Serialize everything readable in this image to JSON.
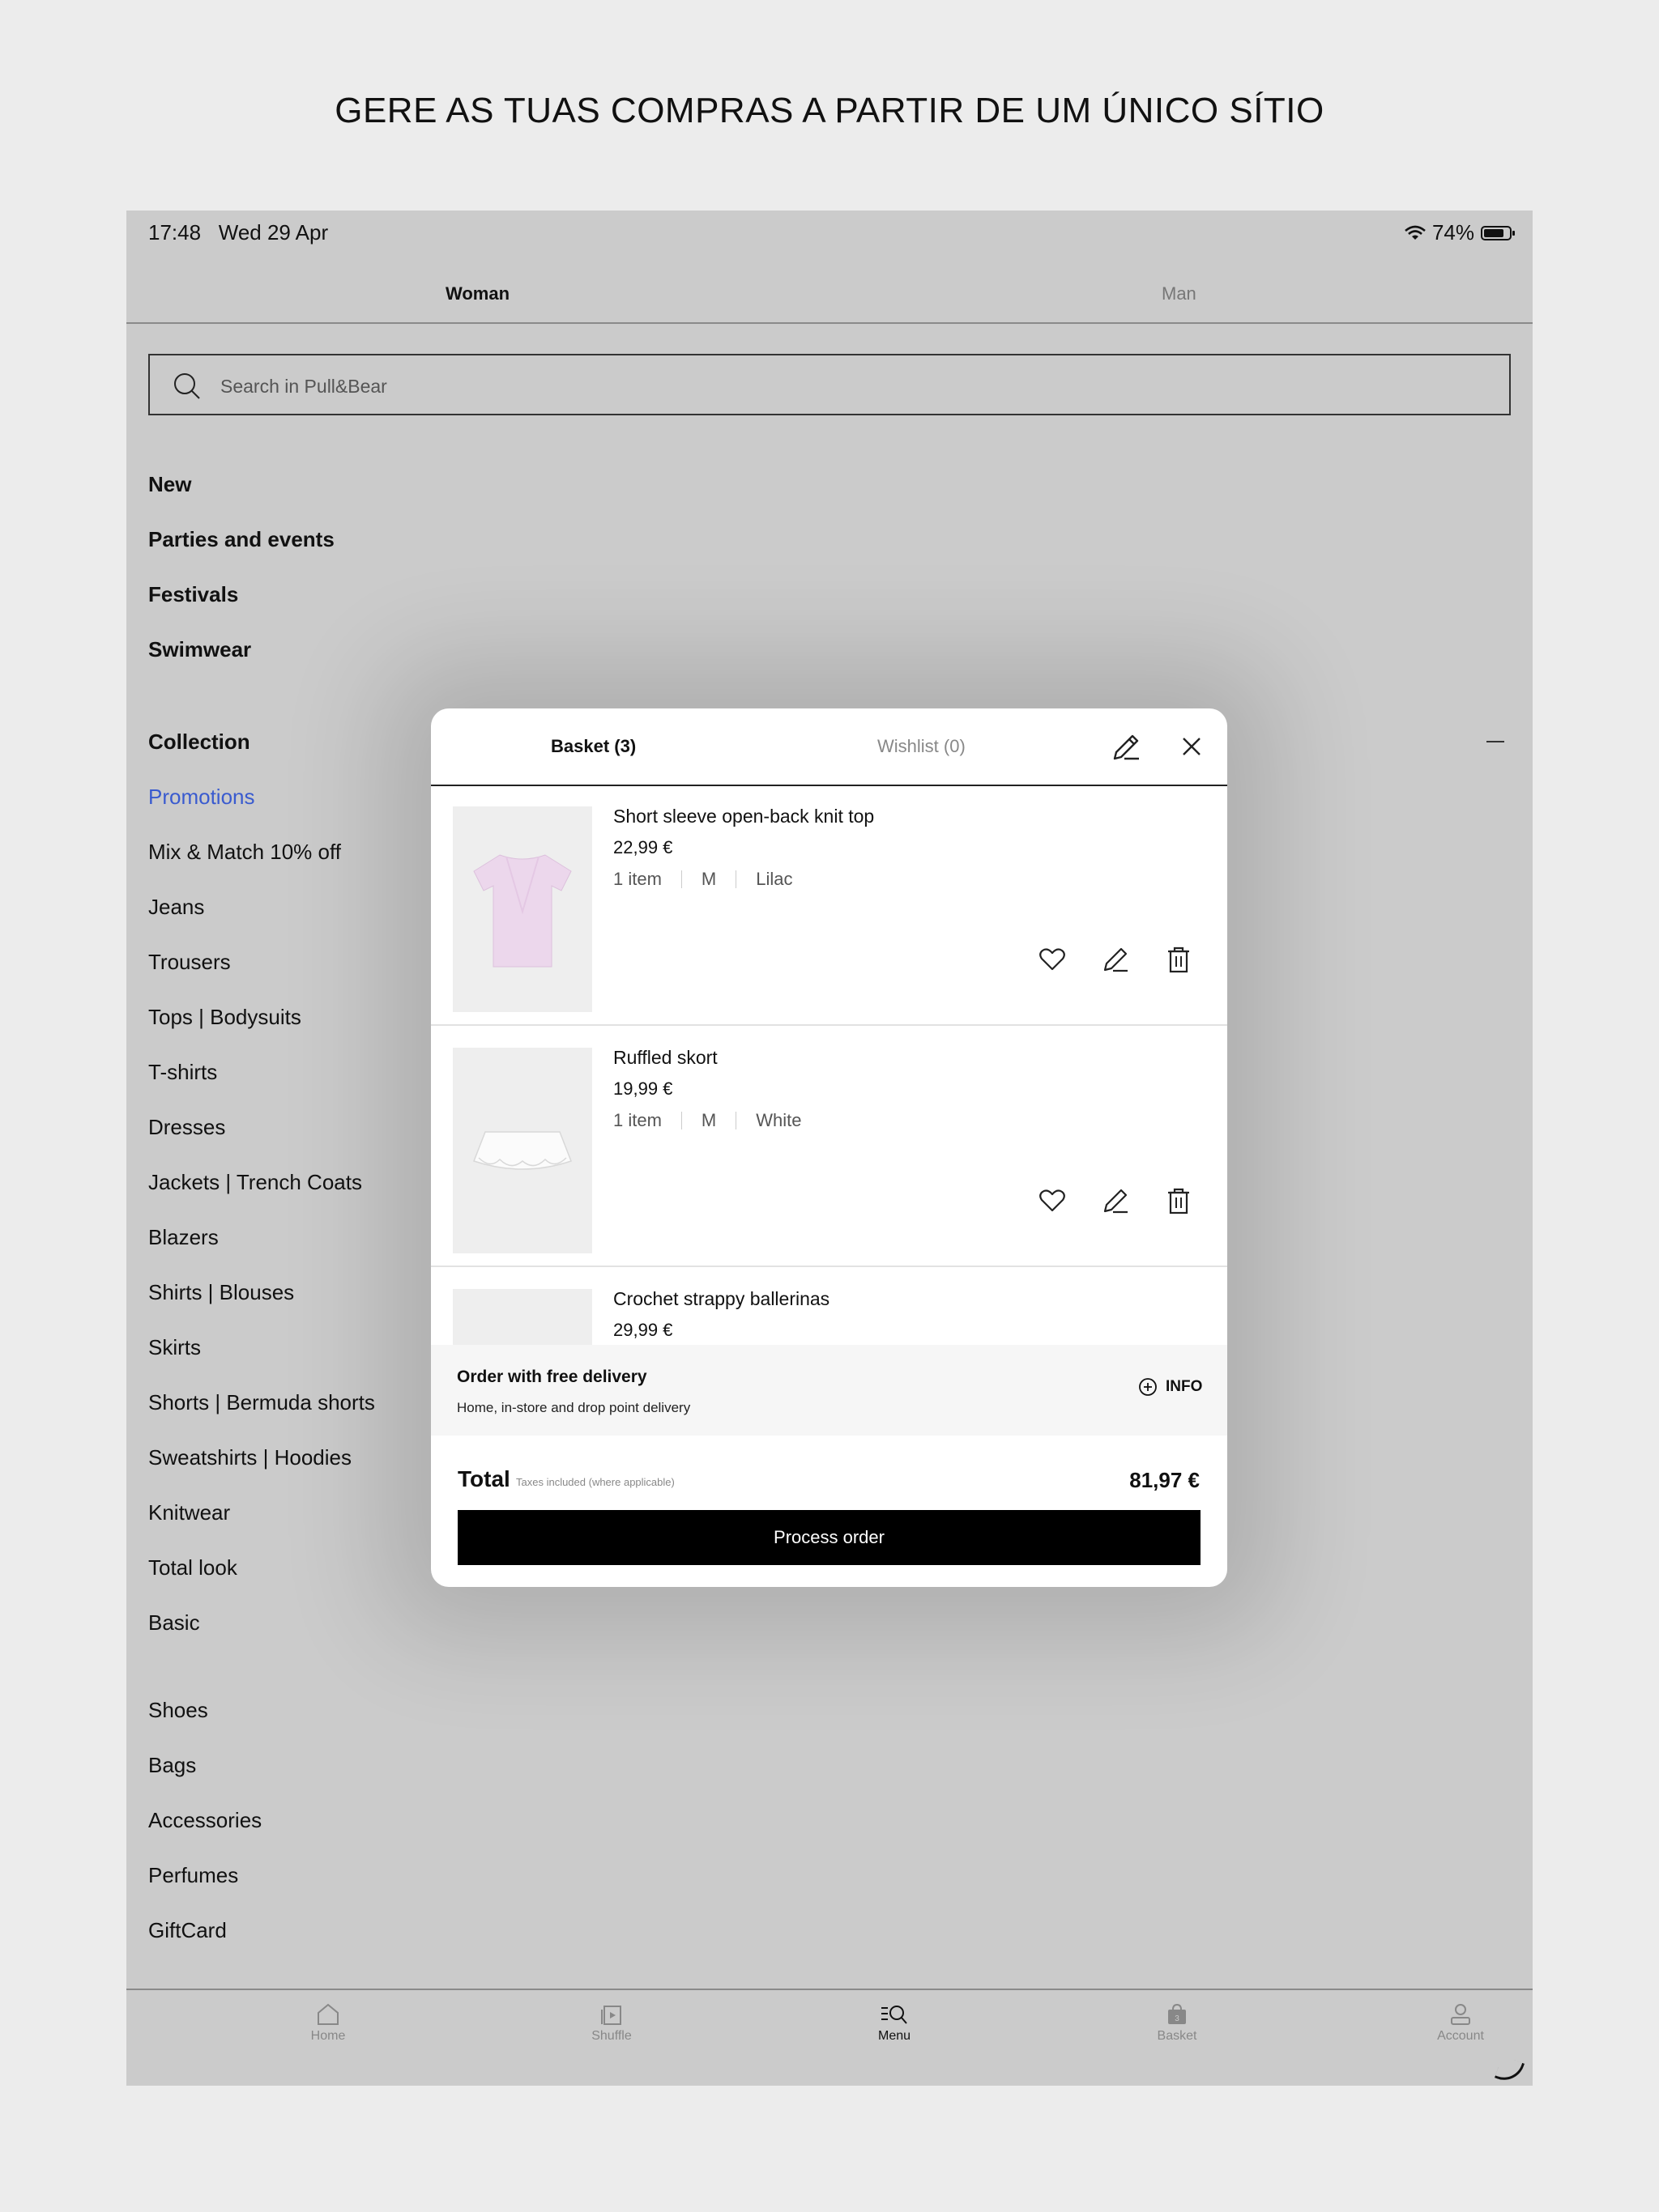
{
  "headline": "GERE AS TUAS COMPRAS A PARTIR DE UM ÚNICO SÍTIO",
  "status_bar": {
    "time": "17:48",
    "date": "Wed 29 Apr",
    "battery": "74%"
  },
  "gender_tabs": {
    "woman": "Woman",
    "man": "Man"
  },
  "search": {
    "placeholder": "Search in Pull&Bear",
    "icon": "search-icon"
  },
  "menu": {
    "featured": [
      "New",
      "Parties and events",
      "Festivals",
      "Swimwear"
    ],
    "collection_header": "Collection",
    "collection": [
      "Promotions",
      "Mix & Match 10% off",
      "Jeans",
      "Trousers",
      "Tops | Bodysuits",
      "T-shirts",
      "Dresses",
      "Jackets | Trench Coats",
      "Blazers",
      "Shirts | Blouses",
      "Skirts",
      "Shorts | Bermuda shorts",
      "Sweatshirts | Hoodies",
      "Knitwear",
      "Total look",
      "Basic"
    ],
    "other": [
      "Shoes",
      "Bags",
      "Accessories",
      "Perfumes",
      "GiftCard"
    ]
  },
  "bottom_tabs": [
    {
      "label": "Home",
      "icon": "home-icon"
    },
    {
      "label": "Shuffle",
      "icon": "shuffle-icon"
    },
    {
      "label": "Menu",
      "icon": "menu-search-icon"
    },
    {
      "label": "Basket",
      "icon": "basket-icon",
      "badge": "3"
    },
    {
      "label": "Account",
      "icon": "account-icon"
    }
  ],
  "basket_modal": {
    "basket_tab": "Basket (3)",
    "wishlist_tab": "Wishlist (0)",
    "items": [
      {
        "name": "Short sleeve open-back knit top",
        "price": "22,99 €",
        "quantity": "1 item",
        "size": "M",
        "color": "Lilac"
      },
      {
        "name": "Ruffled skort",
        "price": "19,99 €",
        "quantity": "1 item",
        "size": "M",
        "color": "White"
      },
      {
        "name": "Crochet strappy ballerinas",
        "price": "29,99 €"
      }
    ],
    "delivery": {
      "title": "Order with free delivery",
      "subtitle": "Home, in-store and drop point delivery",
      "info": "INFO"
    },
    "total_label": "Total",
    "total_note": "Taxes included (where applicable)",
    "total_value": "81,97 €",
    "process_button": "Process order"
  },
  "colors": {
    "overlay_bg": "#cbcbcb",
    "promo_link": "#3a5bcf",
    "button_bg": "#000000"
  }
}
